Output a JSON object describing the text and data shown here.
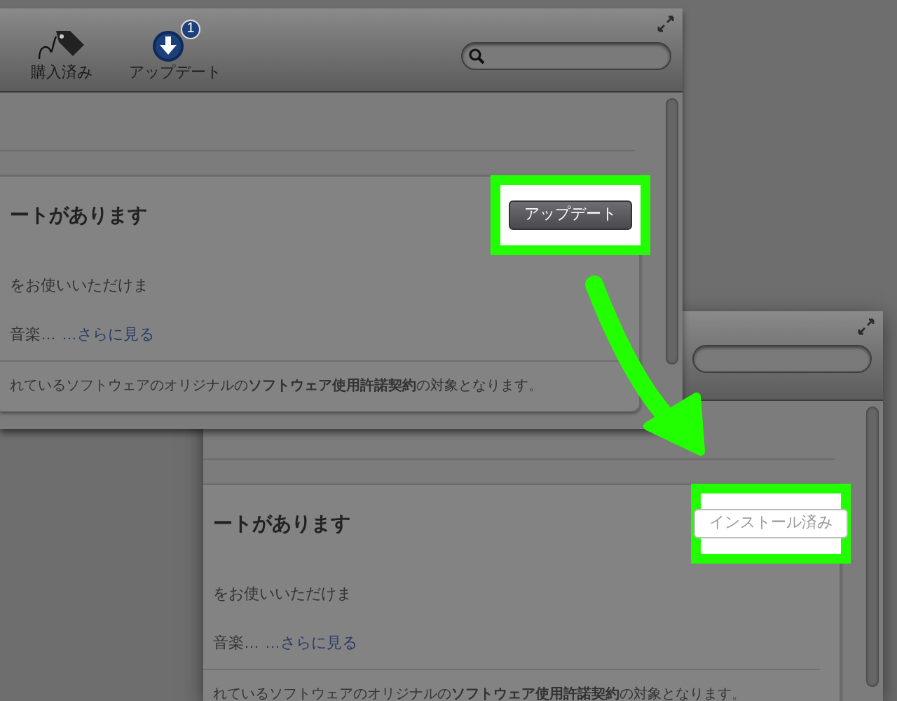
{
  "windows": [
    {
      "tabs": [
        {
          "label": "購入済み",
          "selected": false
        },
        {
          "label": "アップデート",
          "selected": true,
          "badge": "1"
        }
      ],
      "update": {
        "heading": "ートがあります",
        "button": {
          "label": "アップデート",
          "disabled": false
        },
        "line_1": "をお使いいただけま",
        "line_2": "音楽…",
        "more_link": "…さらに見る",
        "footer": "れているソフトウェアのオリジナルの**ソフトウェア使用許諾契約**の対象となります。",
        "highlighted": true
      }
    },
    {
      "update": {
        "heading": "ートがあります",
        "button": {
          "label": "インストール済み",
          "disabled": true
        },
        "line_1": "をお使いいただけま",
        "line_2": "音楽…",
        "more_link": "…さらに見る",
        "footer": "れているソフトウェアのオリジナルの**ソフトウェア使用許諾契約**の対象となります。",
        "highlighted": true
      }
    }
  ]
}
